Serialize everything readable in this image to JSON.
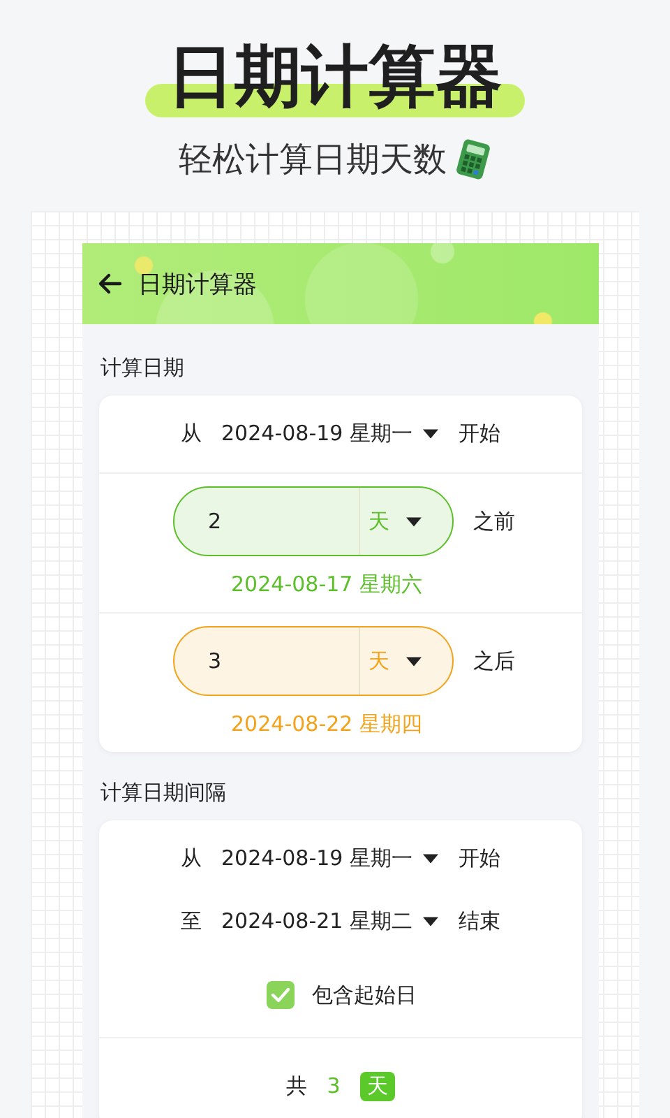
{
  "headline": {
    "title": "日期计算器",
    "subtitle": "轻松计算日期天数"
  },
  "app_bar": {
    "title": "日期计算器"
  },
  "date_offset": {
    "section_title": "计算日期",
    "start": {
      "prefix": "从",
      "date": "2024-08-19 星期一",
      "suffix": "开始"
    },
    "offsets": [
      {
        "value": "2",
        "unit": "天",
        "direction": "之前",
        "result": "2024-08-17 星期六",
        "color": "#5cbf2a"
      },
      {
        "value": "3",
        "unit": "天",
        "direction": "之后",
        "result": "2024-08-22 星期四",
        "color": "#f2a31b"
      }
    ]
  },
  "date_interval": {
    "section_title": "计算日期间隔",
    "rows": [
      {
        "prefix": "从",
        "date": "2024-08-19 星期一",
        "suffix": "开始"
      },
      {
        "prefix": "至",
        "date": "2024-08-21 星期二",
        "suffix": "结束"
      }
    ],
    "include_start": {
      "label": "包含起始日",
      "checked": true
    },
    "total": {
      "prefix": "共",
      "value": "3",
      "unit": "天"
    }
  }
}
